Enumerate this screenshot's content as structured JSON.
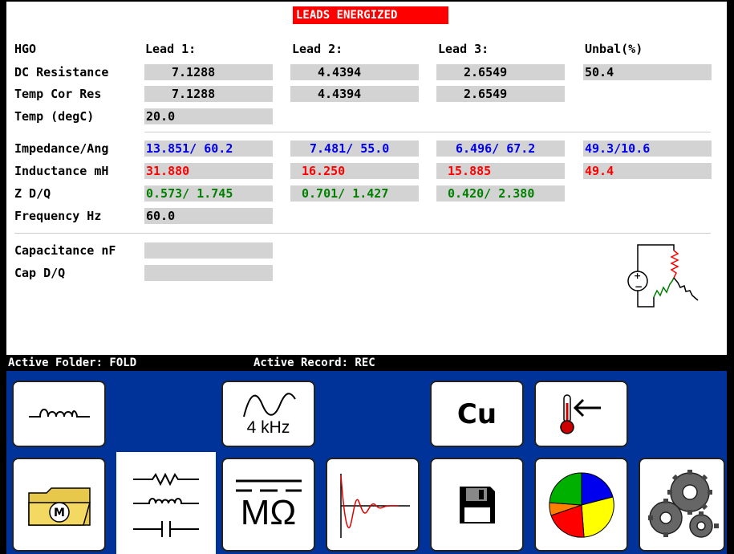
{
  "banner": "LEADS ENERGIZED",
  "headers": [
    "HGO",
    "Lead 1:",
    "Lead 2:",
    "Lead 3:",
    "Unbal(%)"
  ],
  "rows_top": [
    {
      "label": "DC Resistance",
      "lead1": "7.1288",
      "lead2": "4.4394",
      "lead3": "2.6549",
      "unbal": "50.4"
    },
    {
      "label": "Temp Cor Res",
      "lead1": "7.1288",
      "lead2": "4.4394",
      "lead3": "2.6549"
    },
    {
      "label": "Temp (degC)",
      "lead1": "20.0"
    }
  ],
  "rows_mid": [
    {
      "label": "Impedance/Ang",
      "lead1": "13.851/ 60.2",
      "lead2": "7.481/ 55.0",
      "lead3": "6.496/ 67.2",
      "unbal": "49.3/10.6"
    },
    {
      "label": "Inductance mH",
      "lead1": "31.880",
      "lead2": "16.250",
      "lead3": "15.885",
      "unbal": "49.4"
    },
    {
      "label": "Z D/Q",
      "lead1": "0.573/ 1.745",
      "lead2": "0.701/ 1.427",
      "lead3": "0.420/ 2.380"
    },
    {
      "label": "Frequency Hz",
      "lead1": "60.0"
    }
  ],
  "rows_bottom": [
    {
      "label": "Capacitance nF",
      "lead1": ""
    },
    {
      "label": "Cap D/Q",
      "lead1": ""
    }
  ],
  "status": {
    "folder": "Active Folder: FOLD",
    "record": "Active Record: REC"
  },
  "toolbar": {
    "freq_label": "4 kHz",
    "copper_label": "Cu",
    "megohm_label": "MΩ",
    "motor_label": "M"
  },
  "colors": {
    "banner": "#ff0000",
    "toolbar_bg": "#003399",
    "field": "#d3d3d3",
    "blue": "#0000ee",
    "red": "#ff0000",
    "green": "#008000"
  },
  "icons": [
    "inductor-icon",
    "sine-wave-icon",
    "copper-icon",
    "temperature-input-icon",
    "folder-motor-icon",
    "circuit-components-icon",
    "megohm-icon",
    "damped-oscillation-icon",
    "floppy-disk-icon",
    "pie-chart-icon",
    "gears-icon",
    "winding-diagram-icon"
  ]
}
